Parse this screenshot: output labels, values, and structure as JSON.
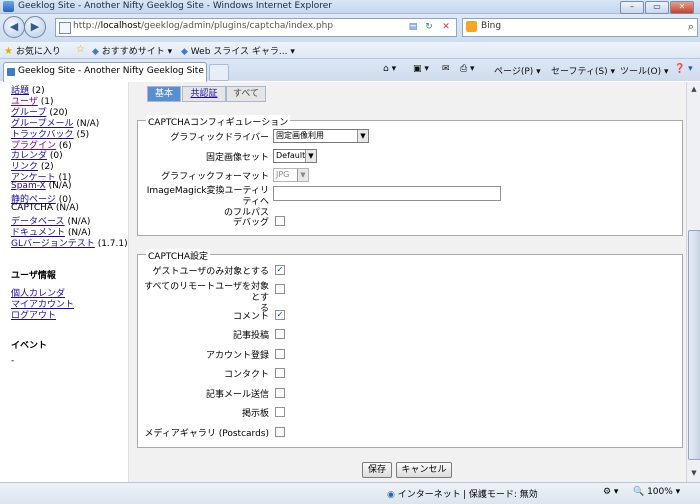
{
  "window": {
    "title": "Geeklog Site - Another Nifty Geeklog Site - Windows Internet Explorer",
    "controls": [
      "–",
      "▭",
      "✕"
    ]
  },
  "address": {
    "url_prefix": "http://",
    "url_host": "localhost",
    "url_path": "/geeklog/admin/plugins/captcha/index.php"
  },
  "search": {
    "engine": "Bing"
  },
  "favorites": {
    "label": "お気に入り",
    "items": [
      "おすすめサイト ▾",
      "Web スライス ギャラ... ▾"
    ]
  },
  "tab": {
    "title": "Geeklog Site - Another Nifty Geeklog Site"
  },
  "commands": {
    "page": "ページ(P) ▾",
    "safety": "セーフティ(S) ▾",
    "tools": "ツール(O) ▾",
    "help": "❓ ▾"
  },
  "sidebar": {
    "items": [
      {
        "label": "話題",
        "count": "(2)",
        "visited": false
      },
      {
        "label": "ユーザ",
        "count": "(1)",
        "visited": true
      },
      {
        "label": "グループ",
        "count": "(20)",
        "visited": false
      },
      {
        "label": "グループメール",
        "count": "(N/A)",
        "visited": false
      },
      {
        "label": "トラックバック",
        "count": "(5)",
        "visited": false
      },
      {
        "label": "プラグイン",
        "count": "(6)",
        "visited": true
      },
      {
        "label": "カレンダ",
        "count": "(0)",
        "visited": false
      },
      {
        "label": "リンク",
        "count": "(2)",
        "visited": false
      },
      {
        "label": "アンケート",
        "count": "(1)",
        "visited": false
      },
      {
        "label": "Spam-X",
        "count": "(N/A)",
        "visited": false
      },
      {
        "label": "静的ページ",
        "count": "(0)",
        "visited": false
      },
      {
        "label": "CAPTCHA",
        "count": "(N/A)",
        "plain": true
      },
      {
        "label": "データベース",
        "count": "(N/A)",
        "visited": false
      },
      {
        "label": "ドキュメント",
        "count": "(N/A)",
        "visited": false
      },
      {
        "label": "GLバージョンテスト",
        "count": "(1.7.1)",
        "visited": false
      }
    ],
    "user_heading": "ユーザ情報",
    "user_links": [
      "個人カレンダ",
      "マイアカウント",
      "ログアウト"
    ],
    "events_heading": "イベント",
    "events_placeholder": "-"
  },
  "subtabs": [
    "基本",
    "共認証",
    "すべて"
  ],
  "captcha_config": {
    "legend": "CAPTCHAコンフィギュレーション",
    "graphic_driver_label": "グラフィックドライバー",
    "graphic_driver_value": "固定画像利用",
    "fixed_image_set_label": "固定画像セット",
    "fixed_image_set_value": "Default",
    "graphic_format_label": "グラフィックフォーマット",
    "graphic_format_value": "JPG",
    "imagemagick_label_1": "ImageMagick変換ユーティリティへ",
    "imagemagick_label_2": "のフルパス",
    "imagemagick_value": "",
    "debug_label": "デバッグ",
    "debug_checked": false
  },
  "captcha_settings": {
    "legend": "CAPTCHA設定",
    "rows": [
      {
        "label": "ゲストユーザのみ対象とする",
        "checked": true
      },
      {
        "label": "すべてのリモートユーザを対象とす",
        "label2": "る",
        "checked": false
      },
      {
        "label": "コメント",
        "checked": true
      },
      {
        "label": "記事投稿",
        "checked": false
      },
      {
        "label": "アカウント登録",
        "checked": false
      },
      {
        "label": "コンタクト",
        "checked": false
      },
      {
        "label": "記事メール送信",
        "checked": false
      },
      {
        "label": "掲示板",
        "checked": false
      },
      {
        "label": "メディアギャラリ (Postcards)",
        "checked": false
      }
    ]
  },
  "buttons": {
    "save": "保存",
    "cancel": "キャンセル"
  },
  "status": {
    "zone": "インターネット",
    "protected_mode": "保護モード: 無効",
    "zoom": "100%"
  }
}
